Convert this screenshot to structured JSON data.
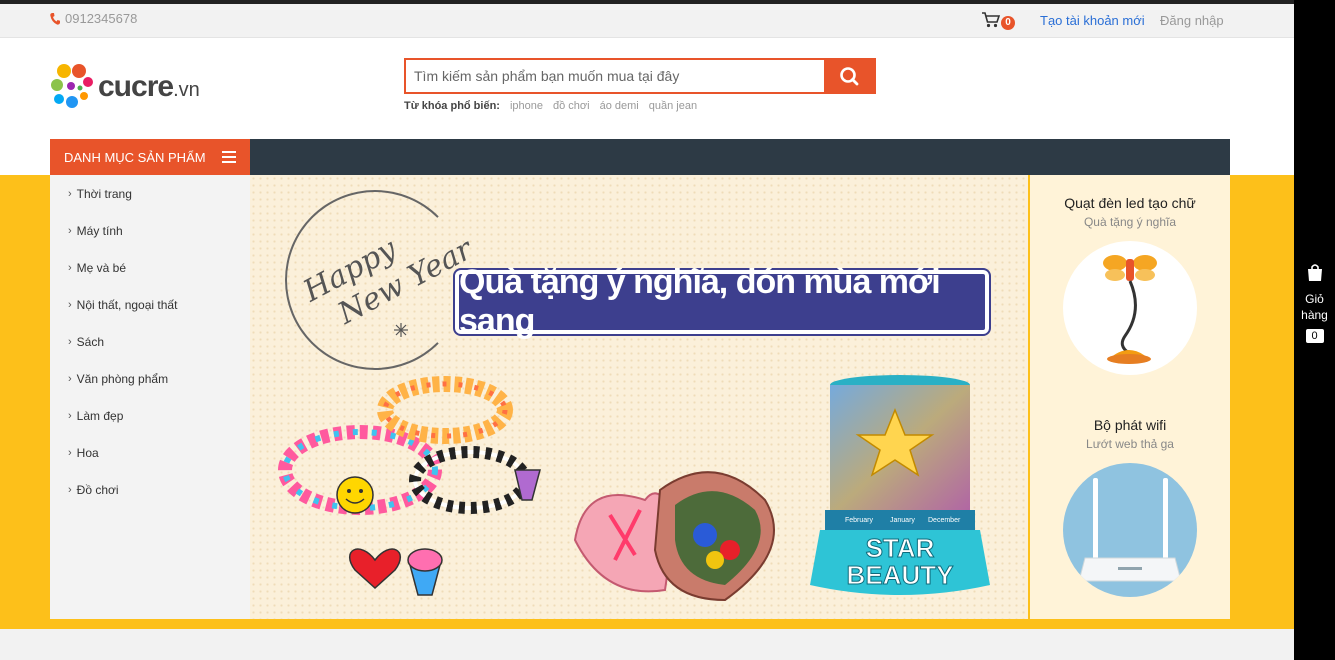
{
  "topbar": {
    "phone": "0912345678",
    "cart_count": "0",
    "register_label": "Tạo tài khoản mới",
    "login_label": "Đăng nhập"
  },
  "logo": {
    "name": "cucre",
    "tld": ".vn"
  },
  "search": {
    "placeholder": "Tìm kiếm sản phẩm bạn muốn mua tại đây",
    "popular_label": "Từ khóa phổ biến:",
    "keywords": [
      "iphone",
      "đồ chơi",
      "áo demi",
      "quần jean"
    ]
  },
  "nav": {
    "category_header": "DANH MỤC SẢN PHẨM"
  },
  "categories": [
    "Thời trang",
    "Máy tính",
    "Mẹ và bé",
    "Nội thất, ngoại thất",
    "Sách",
    "Văn phòng phẩm",
    "Làm đẹp",
    "Hoa",
    "Đồ chơi"
  ],
  "banner": {
    "greeting_line1": "Happy",
    "greeting_line2": "New Year",
    "title": "Quà tặng ý nghĩa, đón mùa mới sang",
    "product_text_line1": "STAR",
    "product_text_line2": "BEAUTY",
    "calendar_months": [
      "February",
      "January",
      "December"
    ]
  },
  "side_products": [
    {
      "name": "Quạt đèn led tạo chữ",
      "subtitle": "Quà tặng ý nghĩa"
    },
    {
      "name": "Bộ phát wifi",
      "subtitle": "Lướt web thả ga"
    }
  ],
  "floating_cart": {
    "label": "Giỏ hàng",
    "count": "0"
  },
  "colors": {
    "accent": "#e8542a",
    "nav_dark": "#2d3a45",
    "band_yellow": "#fdc01a",
    "banner_title_bg": "#3d3f8e"
  }
}
